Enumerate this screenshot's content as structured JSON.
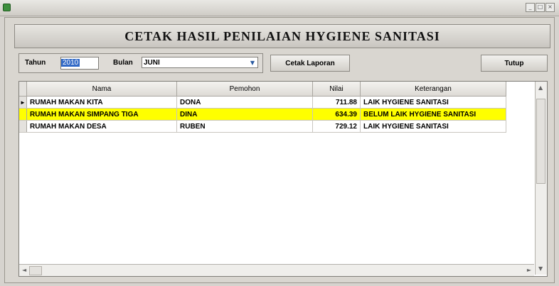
{
  "window": {
    "controls": [
      "_",
      "□",
      "×"
    ]
  },
  "header": {
    "title": "CETAK HASIL PENILAIAN HYGIENE SANITASI"
  },
  "filters": {
    "year_label": "Tahun",
    "year_value": "2010",
    "month_label": "Bulan",
    "month_value": "JUNI"
  },
  "buttons": {
    "print": "Cetak Laporan",
    "close": "Tutup"
  },
  "table": {
    "columns": [
      "Nama",
      "Pemohon",
      "Nilai",
      "Keterangan"
    ],
    "rows": [
      {
        "nama": "RUMAH MAKAN KITA",
        "pemohon": "DONA",
        "nilai": "711.88",
        "keterangan": "LAIK HYGIENE SANITASI",
        "indicator": "►"
      },
      {
        "nama": "RUMAH MAKAN SIMPANG TIGA",
        "pemohon": "DINA",
        "nilai": "634.39",
        "keterangan": "BELUM LAIK HYGIENE SANITASI",
        "indicator": ""
      },
      {
        "nama": "RUMAH MAKAN DESA",
        "pemohon": "RUBEN",
        "nilai": "729.12",
        "keterangan": "LAIK HYGIENE SANITASI",
        "indicator": ""
      }
    ]
  },
  "colors": {
    "highlight": "#ffff00",
    "selection": "#3169c6"
  }
}
